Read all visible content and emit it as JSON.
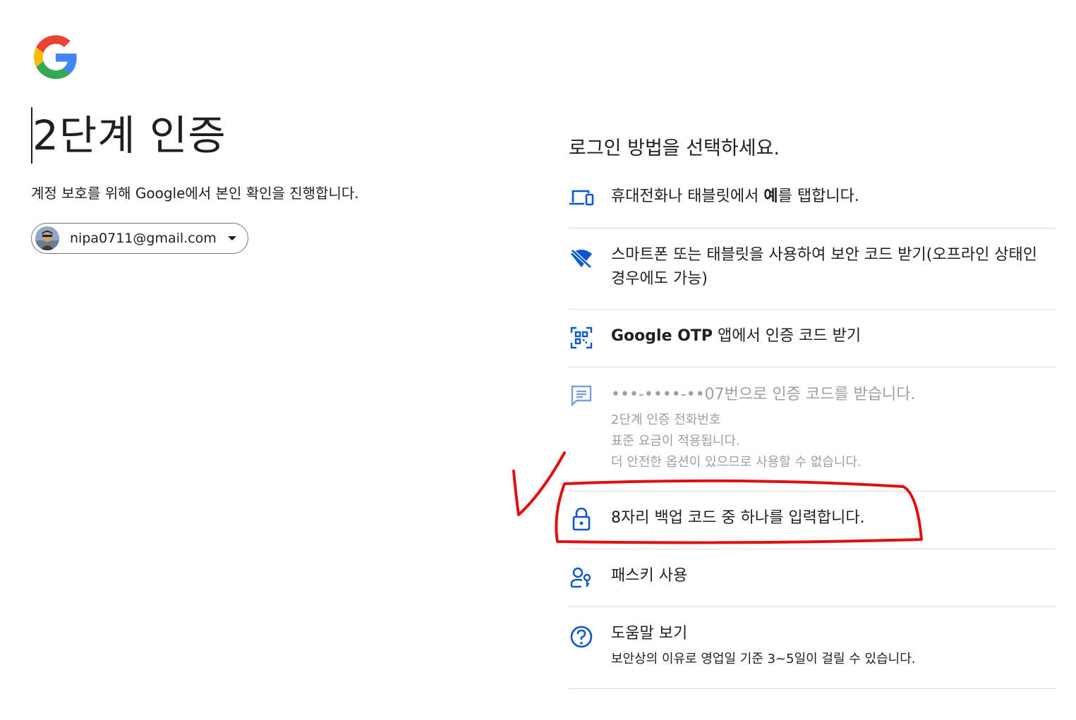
{
  "page": {
    "title": "2단계 인증",
    "subtitle": "계정 보호를 위해 Google에서 본인 확인을 진행합니다.",
    "account_email": "nipa0711@gmail.com"
  },
  "methods": {
    "heading": "로그인 방법을 선택하세요.",
    "items": [
      {
        "icon": "phone-tablet-icon",
        "text_pre": "휴대전화나 태블릿에서 ",
        "text_bold": "예",
        "text_post": "를 탭합니다."
      },
      {
        "icon": "no-wifi-icon",
        "text": "스마트폰 또는 태블릿을 사용하여 보안 코드 받기(오프라인 상태인 경우에도 가능)"
      },
      {
        "icon": "qr-code-icon",
        "text_bold": "Google OTP",
        "text_post": " 앱에서 인증 코드 받기"
      },
      {
        "icon": "sms-icon",
        "text": "•••-••••-••07번으로 인증 코드를 받습니다.",
        "sub1": "2단계 인증 전화번호",
        "sub2": "표준 요금이 적용됩니다.",
        "sub3": "더 안전한 옵션이 있으므로 사용할 수 없습니다.",
        "disabled": true
      },
      {
        "icon": "lock-icon",
        "text": "8자리 백업 코드 중 하나를 입력합니다."
      },
      {
        "icon": "passkey-icon",
        "text": "패스키 사용"
      },
      {
        "icon": "help-icon",
        "text": "도움말 보기",
        "sub1": "보안상의 이유로 영업일 기준 3~5일이 걸릴 수 있습니다."
      }
    ]
  },
  "colors": {
    "accent": "#0b57d0",
    "text": "#1f1f1f",
    "disabled": "#9aa0a6",
    "divider": "#dadce0",
    "annotation": "#e01010"
  }
}
